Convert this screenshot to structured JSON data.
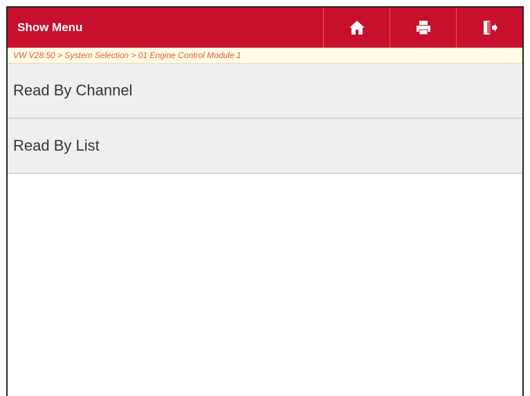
{
  "header": {
    "title": "Show Menu",
    "accent_color": "#c8102e",
    "toolbar": [
      {
        "icon": "home-icon"
      },
      {
        "icon": "print-icon"
      },
      {
        "icon": "exit-icon"
      }
    ]
  },
  "breadcrumb": "VW V28.50 > System Selection > 01 Engine Control Module 1",
  "menu": {
    "items": [
      {
        "label": "Read By Channel"
      },
      {
        "label": "Read By List"
      }
    ]
  }
}
